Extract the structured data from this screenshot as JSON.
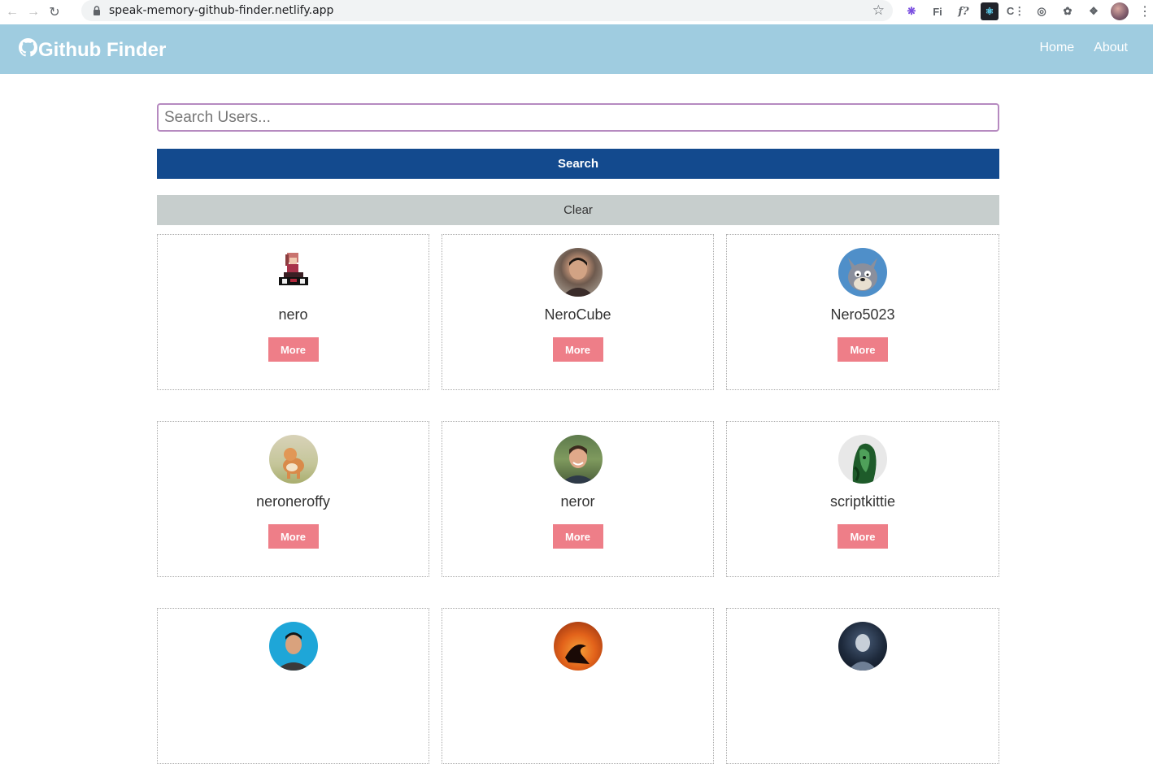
{
  "browser": {
    "url": "speak-memory-github-finder.netlify.app"
  },
  "navbar": {
    "brand": "Github Finder",
    "links": [
      {
        "label": "Home"
      },
      {
        "label": "About"
      }
    ],
    "background": "#9fcce0"
  },
  "search": {
    "placeholder": "Search Users...",
    "value": "",
    "search_label": "Search",
    "clear_label": "Clear"
  },
  "users": [
    {
      "login": "nero",
      "more_label": "More",
      "avatar_icon": "pixel-girl-avatar"
    },
    {
      "login": "NeroCube",
      "more_label": "More",
      "avatar_icon": "person-photo-avatar"
    },
    {
      "login": "Nero5023",
      "more_label": "More",
      "avatar_icon": "cartoon-cat-avatar"
    },
    {
      "login": "neroneroffy",
      "more_label": "More",
      "avatar_icon": "dog-photo-avatar"
    },
    {
      "login": "neror",
      "more_label": "More",
      "avatar_icon": "person-photo-avatar"
    },
    {
      "login": "scriptkittie",
      "more_label": "More",
      "avatar_icon": "green-art-avatar"
    },
    {
      "login": "",
      "more_label": "",
      "avatar_icon": "person-blue-background-avatar"
    },
    {
      "login": "",
      "more_label": "",
      "avatar_icon": "sunset-silhouette-avatar"
    },
    {
      "login": "",
      "more_label": "",
      "avatar_icon": "dark-figure-avatar"
    }
  ],
  "colors": {
    "primary": "#134a8e",
    "light": "#c7cecd",
    "more_button": "#ee7e88",
    "input_border": "#b68ac0"
  }
}
